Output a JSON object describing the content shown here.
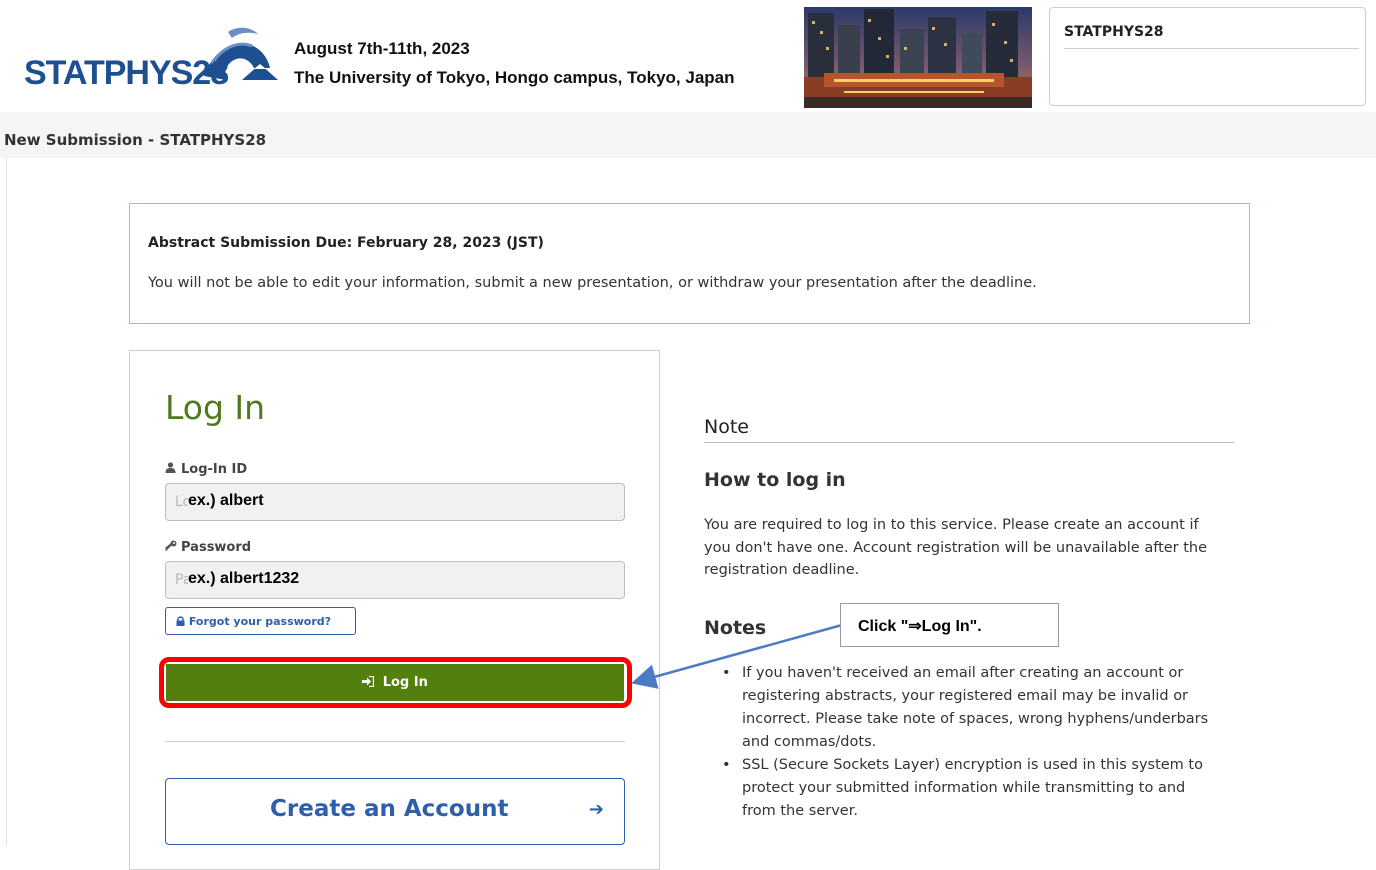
{
  "header": {
    "logo_text": "STATPHYS28",
    "dates": "August 7th-11th, 2023",
    "venue": "The University of Tokyo, Hongo campus, Tokyo, Japan",
    "side_title": "STATPHYS28"
  },
  "subheader": {
    "title": "New Submission - STATPHYS28"
  },
  "notice": {
    "heading": "Abstract Submission Due: February 28, 2023 (JST)",
    "text": "You will not be able to edit your information, submit a new presentation, or withdraw your presentation after the deadline."
  },
  "login": {
    "title": "Log In",
    "id_label": "Log-In ID",
    "id_placeholder": "Log-In ID",
    "id_example": "ex.) albert",
    "password_label": "Password",
    "password_placeholder": "Password",
    "password_example": "ex.) albert1232",
    "forgot_label": "Forgot your password?",
    "login_button": "Log In",
    "create_account": "Create an Account"
  },
  "note": {
    "heading": "Note",
    "howto_title": "How to log in",
    "howto_text": "You are required to log in to this service. Please create an account if you don't have one. Account registration will be unavailable after the registration deadline.",
    "notes_title": "Notes",
    "items": [
      "If you haven't received an email after creating an account or registering abstracts, your registered email may be invalid or incorrect. Please take note of spaces, wrong hyphens/underbars and commas/dots.",
      "SSL (Secure Sockets Layer) encryption is used in this system to protect your submitted information while transmitting to and from the server."
    ]
  },
  "annotation": {
    "callout": "Click  \"⇒Log In\"."
  },
  "colors": {
    "brand_blue": "#1d4f91",
    "login_green": "#527f0e",
    "title_green": "#4f7a1c",
    "notice_border": "#f0b429",
    "highlight_red": "#ff0000",
    "link_blue": "#2f5fa8"
  }
}
